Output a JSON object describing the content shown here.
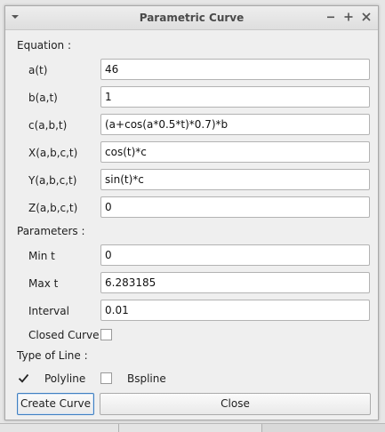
{
  "window": {
    "title": "Parametric Curve",
    "menu_icon": "chevron-down-icon",
    "controls": [
      "minimize-icon",
      "maximize-icon",
      "close-icon"
    ]
  },
  "equation": {
    "header": "Equation :",
    "fields": [
      {
        "label": "a(t)",
        "value": "46"
      },
      {
        "label": "b(a,t)",
        "value": "1"
      },
      {
        "label": "c(a,b,t)",
        "value": "(a+cos(a*0.5*t)*0.7)*b"
      },
      {
        "label": "X(a,b,c,t)",
        "value": "cos(t)*c"
      },
      {
        "label": "Y(a,b,c,t)",
        "value": "sin(t)*c"
      },
      {
        "label": "Z(a,b,c,t)",
        "value": "0"
      }
    ]
  },
  "parameters": {
    "header": "Parameters :",
    "fields": [
      {
        "label": "Min t",
        "value": "0"
      },
      {
        "label": "Max t",
        "value": "6.283185"
      },
      {
        "label": "Interval",
        "value": "0.01"
      }
    ],
    "closed_curve": {
      "label": "Closed Curve",
      "checked": false
    }
  },
  "line_type": {
    "header": "Type of Line :",
    "options": [
      {
        "label": "Polyline",
        "checked": true
      },
      {
        "label": "Bspline",
        "checked": false
      }
    ]
  },
  "buttons": {
    "create": "Create Curve",
    "close": "Close"
  }
}
